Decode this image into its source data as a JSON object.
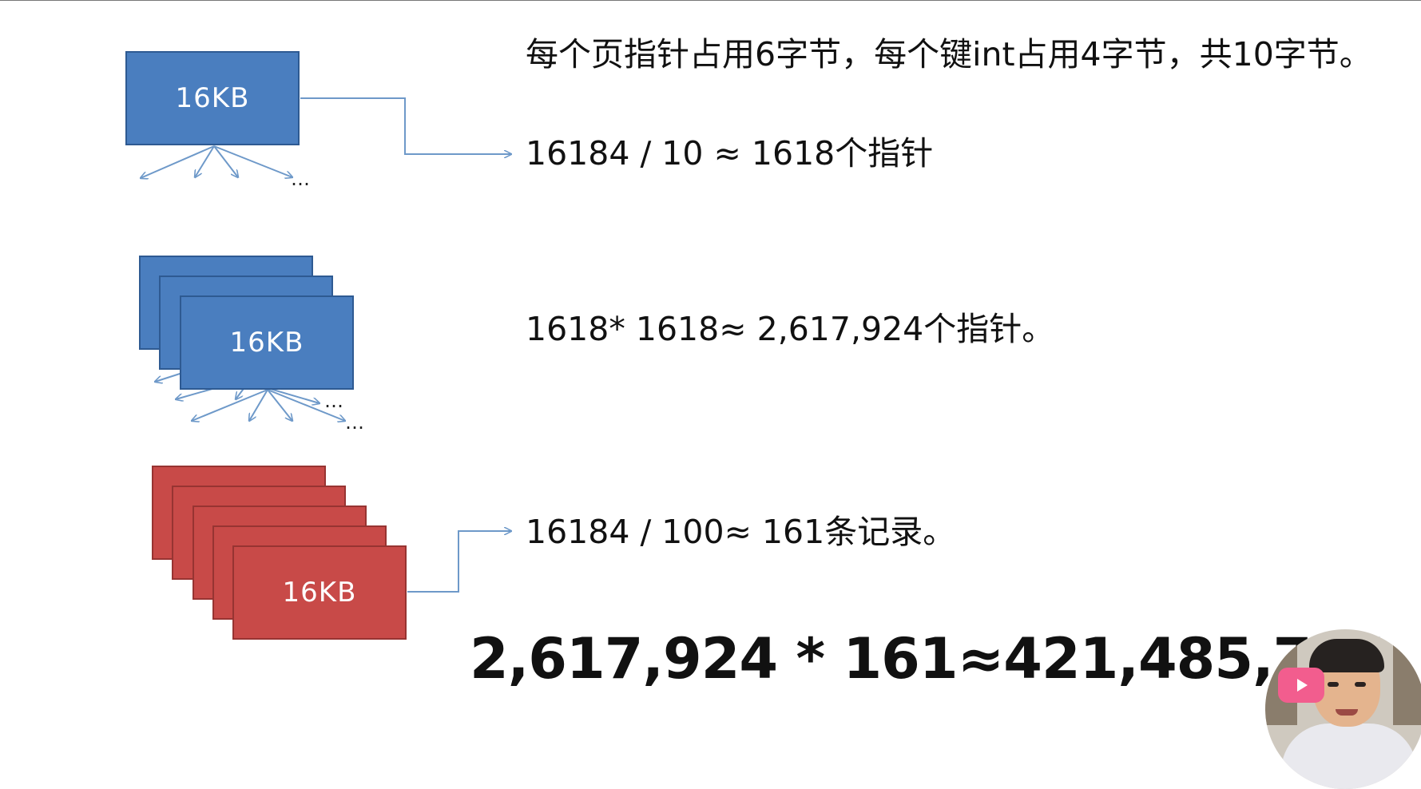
{
  "slide": {
    "line1": "每个页指针占用6字节，每个键int占用4字节，共10字节。",
    "line2": "16184 / 10 ≈ 1618个指针",
    "line3": "1618* 1618≈ 2,617,924个指针。",
    "line4": "16184 / 100≈ 161条记录。",
    "result": "2,617,924 * 161≈421,485,764",
    "box_label": "16KB",
    "ellipsis": "…"
  },
  "colors": {
    "internal_page": "#4a7ebf",
    "leaf_page": "#c84a48",
    "connector": "#6e99c9"
  },
  "icons": [
    "play-badge-icon"
  ],
  "overlay": {
    "webcam": "presenter-webcam"
  }
}
